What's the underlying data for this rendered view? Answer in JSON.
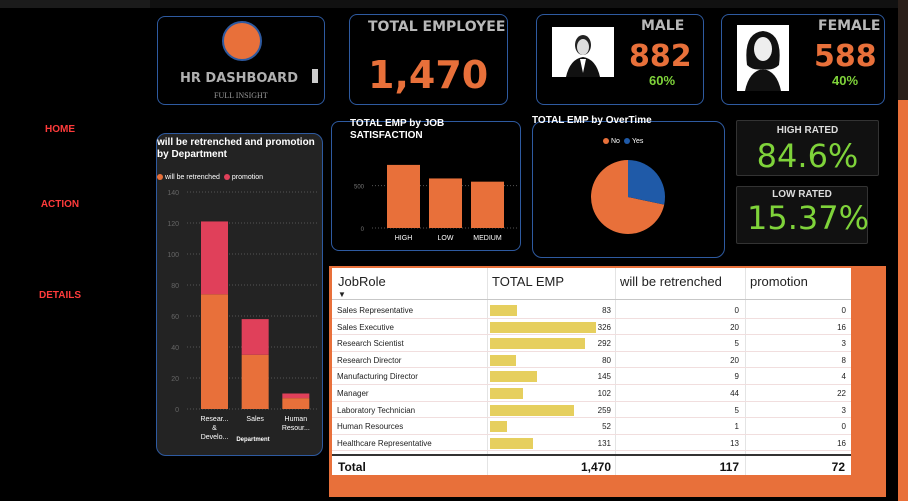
{
  "nav": {
    "home": "HOME",
    "action": "ACTION",
    "details": "DETAILS"
  },
  "logo": {
    "title": "HR DASHBOARD",
    "subtitle": "FULL INSIGHT"
  },
  "kpi": {
    "total_title": "TOTAL EMPLOYEE",
    "total_value": "1,470",
    "male_title": "MALE",
    "male_value": "882",
    "male_pct": "60%",
    "female_title": "FEMALE",
    "female_value": "588",
    "female_pct": "40%"
  },
  "rated": {
    "high_title": "HIGH RATED",
    "high_value": "84.6%",
    "low_title": "LOW RATED",
    "low_value": "15.37%"
  },
  "chart_data": [
    {
      "type": "bar",
      "title": "will be retrenched and promotion by Department",
      "xlabel": "Department",
      "ylabel": "",
      "ylim": [
        0,
        140
      ],
      "yticks": [
        0,
        20,
        40,
        60,
        80,
        100,
        120,
        140
      ],
      "categories": [
        "Resear... & Develo...",
        "Sales",
        "Human Resour..."
      ],
      "series": [
        {
          "name": "will be retrenched",
          "color": "#e8703a",
          "values": [
            74,
            35,
            7
          ]
        },
        {
          "name": "promotion",
          "color": "#e0405a",
          "values": [
            47,
            23,
            3
          ]
        }
      ],
      "stacked": true,
      "legend": "top-left",
      "grid": true
    },
    {
      "type": "bar",
      "title": "TOTAL EMP by JOB SATISFACTION",
      "categories": [
        "HIGH",
        "LOW",
        "MEDIUM"
      ],
      "values": [
        745,
        585,
        547
      ],
      "ylim": [
        0,
        850
      ],
      "yticks": [
        0,
        500
      ],
      "color": "#e8703a",
      "grid": true
    },
    {
      "type": "pie",
      "title": "TOTAL EMP by OverTime",
      "labels": [
        "No",
        "Yes"
      ],
      "values": [
        1054,
        416
      ],
      "colors": [
        "#e8703a",
        "#1f5aa8"
      ],
      "legend": "top"
    }
  ],
  "table": {
    "headers": [
      "JobRole",
      "TOTAL EMP",
      "will be retrenched",
      "promotion"
    ],
    "rows": [
      {
        "role": "Sales Representative",
        "total": 83,
        "retrenched": 0,
        "promotion": 0
      },
      {
        "role": "Sales Executive",
        "total": 326,
        "retrenched": 20,
        "promotion": 16
      },
      {
        "role": "Research Scientist",
        "total": 292,
        "retrenched": 5,
        "promotion": 3
      },
      {
        "role": "Research Director",
        "total": 80,
        "retrenched": 20,
        "promotion": 8
      },
      {
        "role": "Manufacturing Director",
        "total": 145,
        "retrenched": 9,
        "promotion": 4
      },
      {
        "role": "Manager",
        "total": 102,
        "retrenched": 44,
        "promotion": 22
      },
      {
        "role": "Laboratory Technician",
        "total": 259,
        "retrenched": 5,
        "promotion": 3
      },
      {
        "role": "Human Resources",
        "total": 52,
        "retrenched": 1,
        "promotion": 0
      },
      {
        "role": "Healthcare Representative",
        "total": 131,
        "retrenched": 13,
        "promotion": 16
      }
    ],
    "footer": {
      "label": "Total",
      "total": "1,470",
      "retrenched": "117",
      "promotion": "72"
    },
    "bar_color": "#e6cf5e"
  }
}
